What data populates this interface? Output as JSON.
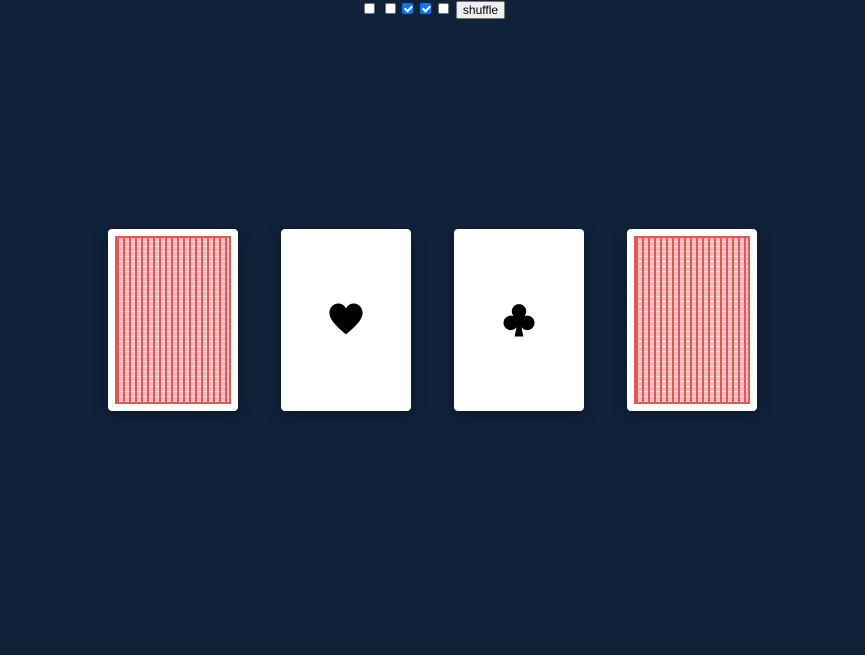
{
  "controls": {
    "checkboxes": [
      {
        "checked": false
      },
      {
        "checked": false
      },
      {
        "checked": true
      },
      {
        "checked": true
      },
      {
        "checked": false
      }
    ],
    "shuffle_label": "shuffle"
  },
  "cards": [
    {
      "face": "back",
      "pattern_color": "#e05858"
    },
    {
      "face": "up",
      "suit": "heart-icon",
      "color": "#000000"
    },
    {
      "face": "up",
      "suit": "club-icon",
      "color": "#000000"
    },
    {
      "face": "back",
      "pattern_color": "#e05858"
    }
  ],
  "colors": {
    "background": "#10223a",
    "card": "#ffffff",
    "checkbox_accent": "#0075ff"
  }
}
